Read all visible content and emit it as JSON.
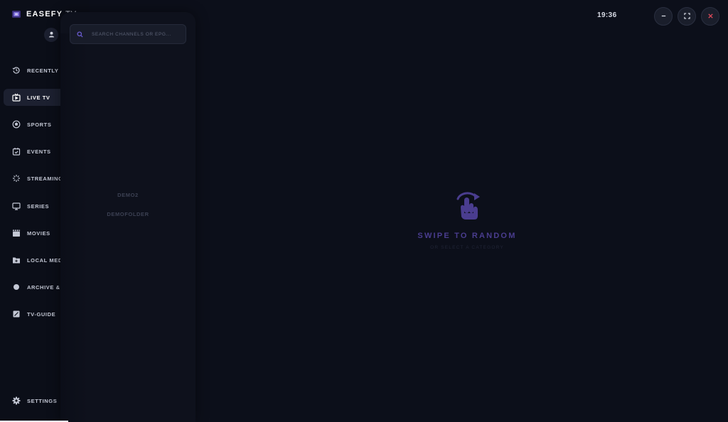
{
  "app": {
    "brand": "EASEFY",
    "brand_suffix": ".TV"
  },
  "clock": "19:36",
  "sidebar": {
    "items": [
      {
        "label": "RECENTLY VIEWED",
        "icon": "history-icon"
      },
      {
        "label": "LIVE TV",
        "icon": "live-tv-icon",
        "active": true
      },
      {
        "label": "SPORTS",
        "icon": "sports-ball-icon"
      },
      {
        "label": "EVENTS",
        "icon": "calendar-icon"
      },
      {
        "label": "STREAMING",
        "icon": "streaming-icon"
      },
      {
        "label": "SERIES",
        "icon": "monitor-icon"
      },
      {
        "label": "MOVIES",
        "icon": "clapperboard-icon"
      },
      {
        "label": "LOCAL MEDIA",
        "icon": "folder-icon"
      },
      {
        "label": "ARCHIVE & CATCHUP",
        "icon": "archive-icon"
      },
      {
        "label": "TV-GUIDE",
        "icon": "guide-icon"
      }
    ],
    "settings_label": "SETTINGS"
  },
  "search": {
    "placeholder": "SEARCH CHANNELS OR EPG..."
  },
  "categories": [
    "DEMO2",
    "DEMOFOLDER"
  ],
  "center": {
    "title": "SWIPE TO RANDOM",
    "subtitle": "OR SELECT A CATEGORY"
  },
  "window_buttons": [
    "minimize-icon",
    "fullscreen-icon",
    "close-icon"
  ],
  "colors": {
    "accent": "#4a3d8f",
    "close": "#e04b5b",
    "background": "#0c0f1a"
  }
}
